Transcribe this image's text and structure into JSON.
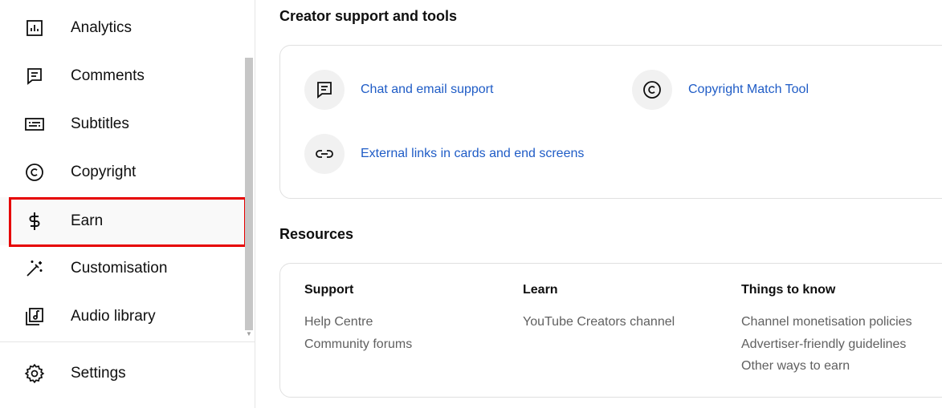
{
  "sidebar": {
    "items": [
      {
        "label": "Analytics",
        "icon": "analytics-icon"
      },
      {
        "label": "Comments",
        "icon": "comments-icon"
      },
      {
        "label": "Subtitles",
        "icon": "subtitles-icon"
      },
      {
        "label": "Copyright",
        "icon": "copyright-icon"
      },
      {
        "label": "Earn",
        "icon": "dollar-icon",
        "active": true
      },
      {
        "label": "Customisation",
        "icon": "magic-wand-icon"
      },
      {
        "label": "Audio library",
        "icon": "audio-library-icon"
      }
    ],
    "settings_label": "Settings",
    "highlight_color": "#e60000"
  },
  "main": {
    "creator_support": {
      "title": "Creator support and tools",
      "tools": [
        {
          "label": "Chat and email support",
          "icon": "chat-icon"
        },
        {
          "label": "Copyright Match Tool",
          "icon": "copyright-icon"
        },
        {
          "label": "External links in cards and end screens",
          "icon": "link-icon"
        }
      ]
    },
    "resources": {
      "title": "Resources",
      "columns": [
        {
          "heading": "Support",
          "links": [
            "Help Centre",
            "Community forums"
          ]
        },
        {
          "heading": "Learn",
          "links": [
            "YouTube Creators channel"
          ]
        },
        {
          "heading": "Things to know",
          "links": [
            "Channel monetisation policies",
            "Advertiser-friendly guidelines",
            "Other ways to earn"
          ]
        }
      ]
    }
  },
  "colors": {
    "link": "#1f5cc6",
    "secondary_text": "#606060"
  }
}
